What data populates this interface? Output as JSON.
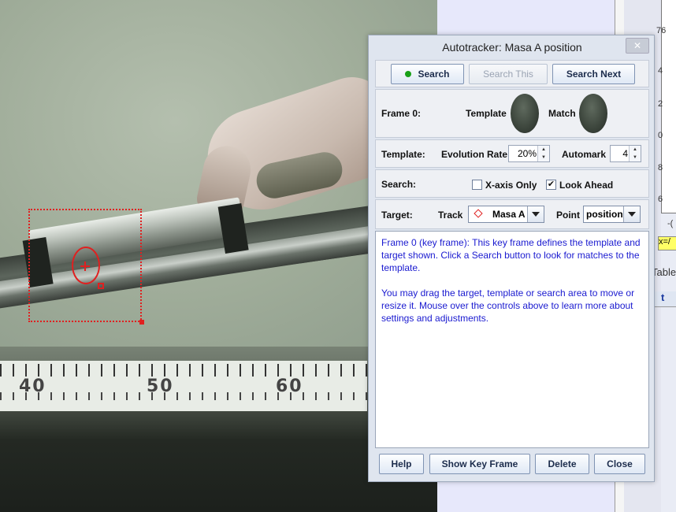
{
  "video": {
    "ruler_labels": [
      "40",
      "50",
      "60"
    ]
  },
  "background_app": {
    "y_ticks": [
      "76",
      "4",
      "2",
      "0",
      "8",
      "6"
    ],
    "x_tick": "-(",
    "x_readout": "x=/",
    "table_tab": "Table",
    "table_column": "t"
  },
  "dialog": {
    "title": "Autotracker: Masa A position",
    "close_glyph": "✕",
    "search_buttons": {
      "search": "Search",
      "search_this": "Search This",
      "search_next": "Search Next"
    },
    "frame_row": {
      "frame_label": "Frame 0:",
      "template_label": "Template",
      "match_label": "Match"
    },
    "template_row": {
      "label": "Template:",
      "evolution_rate_label": "Evolution Rate",
      "evolution_rate_value": "20%",
      "automark_label": "Automark",
      "automark_value": "4"
    },
    "search_row": {
      "label": "Search:",
      "x_axis_only_label": "X-axis Only",
      "x_axis_only_checked": false,
      "look_ahead_label": "Look Ahead",
      "look_ahead_checked": true,
      "check_mark": "✔"
    },
    "target_row": {
      "label": "Target:",
      "track_label": "Track",
      "track_value": "Masa A",
      "point_label": "Point",
      "point_value": "position"
    },
    "info": {
      "paragraph1": "Frame 0 (key frame): This key frame defines the template and target shown. Click a Search button to look for matches to the template.",
      "paragraph2": "You may drag the target, template or search area to move or resize it.  Mouse over the controls above to learn more about settings and adjustments."
    },
    "bottom_buttons": {
      "help": "Help",
      "show_key_frame": "Show Key Frame",
      "delete": "Delete",
      "close": "Close"
    },
    "colors": {
      "search_indicator": "#18a018",
      "info_text": "#1a1ad0",
      "tracker_red": "#e02020"
    }
  }
}
